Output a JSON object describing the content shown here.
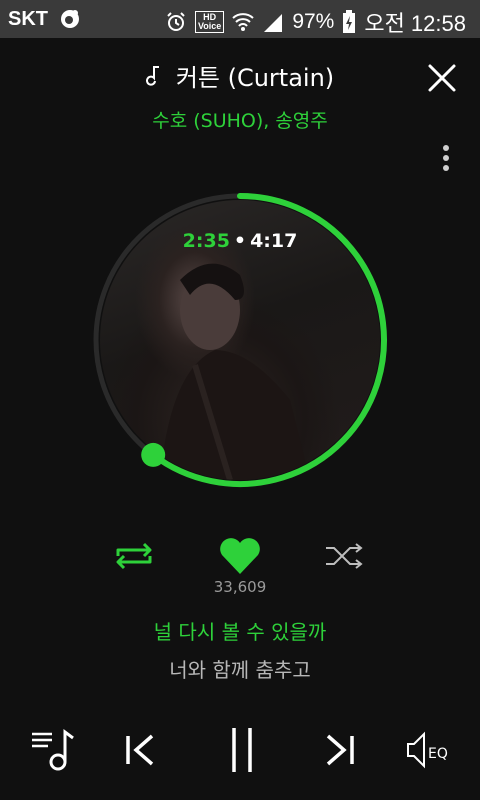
{
  "status_bar": {
    "carrier": "SKT",
    "hd_label": "HD",
    "voice_label": "Voice",
    "battery_percent": "97%",
    "time": "오전 12:58"
  },
  "player": {
    "title": "커튼 (Curtain)",
    "artist": "수호 (SUHO), 송영주",
    "current_time": "2:35",
    "separator": "•",
    "duration": "4:17",
    "progress": 0.603,
    "like_count": "33,609",
    "eq_label": "EQ"
  },
  "lyrics": {
    "current": "널 다시 볼 수 있을까",
    "next": "너와 함께 춤추고"
  },
  "colors": {
    "accent": "#2ed13a",
    "background": "#101010",
    "status_bar": "#3a3a3a"
  },
  "icons": {
    "title": "music-note-icon",
    "close": "close-icon",
    "more": "more-vertical-icon",
    "repeat": "repeat-icon",
    "like": "heart-icon",
    "shuffle": "shuffle-icon",
    "playlist": "playlist-icon",
    "prev": "skip-previous-icon",
    "pause": "pause-icon",
    "next": "skip-next-icon",
    "eq": "equalizer-speaker-icon"
  }
}
